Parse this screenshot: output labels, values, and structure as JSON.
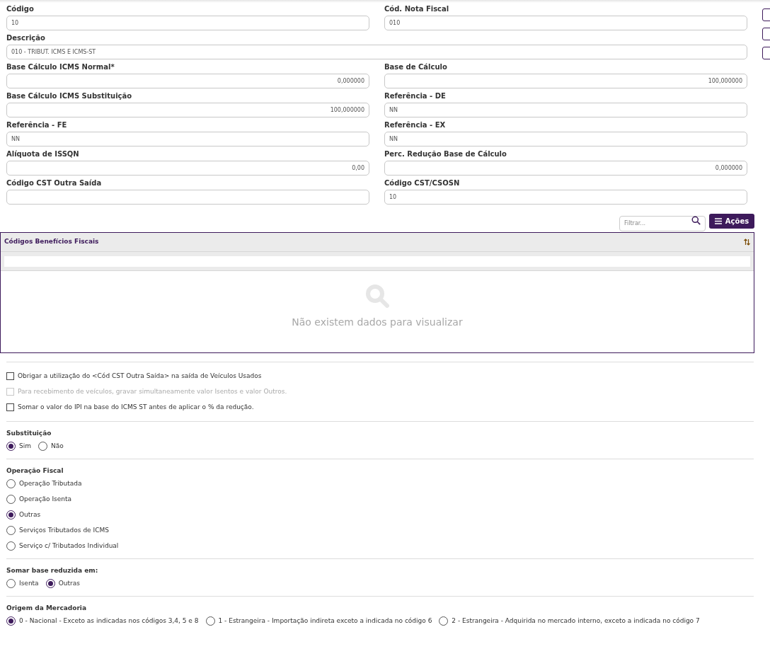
{
  "fields": [
    {
      "label": "Código",
      "value": "10",
      "kind": "text"
    },
    {
      "label": "Cód. Nota Fiscal",
      "value": "010",
      "kind": "text"
    },
    {
      "label": "Descrição",
      "value": "010 - TRIBUT. ICMS E ICMS-ST",
      "kind": "wide"
    },
    {
      "label": "Base Cálculo ICMS Normal*",
      "value": "0,000000",
      "kind": "number"
    },
    {
      "label": "Base de Cálculo",
      "value": "100,000000",
      "kind": "number"
    },
    {
      "label": "Base Cálculo ICMS Substituição",
      "value": "100,000000",
      "kind": "number"
    },
    {
      "label": "Referência - DE",
      "value": "NN",
      "kind": "text"
    },
    {
      "label": "Referência - FE",
      "value": "NN",
      "kind": "text"
    },
    {
      "label": "Referência - EX",
      "value": "NN",
      "kind": "text"
    },
    {
      "label": "Alíquota de ISSQN",
      "value": "0,00",
      "kind": "number"
    },
    {
      "label": "Perc. Redução Base de Cálculo",
      "value": "0,000000",
      "kind": "number"
    },
    {
      "label": "Código CST Outra Saída",
      "kind": "text"
    },
    {
      "label": "Código CST/CSOSN",
      "value": "10",
      "kind": "text"
    }
  ],
  "filter": {
    "placeholder": "Filtrar..."
  },
  "actions_button": {
    "label": "Ações"
  },
  "grid": {
    "title": "Códigos Benefícios Fiscais",
    "empty_message": "Não existem dados para visualizar"
  },
  "checkboxes": [
    {
      "label": "Obrigar a utilização do <Cód CST Outra Saída> na saída de Veículos Usados",
      "checked": false,
      "disabled": false
    },
    {
      "label": "Para recebimento de veículos, gravar simultaneamente valor Isentos e valor Outros.",
      "checked": false,
      "disabled": true
    },
    {
      "label": "Somar o valor do IPI na base do ICMS ST antes de aplicar o % da redução.",
      "checked": false,
      "disabled": false
    }
  ],
  "radio_groups": [
    {
      "title": "Substituição",
      "kind": "inline",
      "options": [
        {
          "label": "Sim",
          "selected": true
        },
        {
          "label": "Não",
          "selected": false
        }
      ]
    },
    {
      "title": "Operação Fiscal",
      "kind": "list",
      "options": [
        {
          "label": "Operação Tributada",
          "selected": false
        },
        {
          "label": "Operação Isenta",
          "selected": false
        },
        {
          "label": "Outras",
          "selected": true
        },
        {
          "label": "Serviços Tributados de ICMS",
          "selected": false
        },
        {
          "label": "Serviço c/ Tributados Individual",
          "selected": false
        }
      ]
    },
    {
      "title": "Somar base reduzida em:",
      "kind": "inline",
      "options": [
        {
          "label": "Isenta",
          "selected": false
        },
        {
          "label": "Outras",
          "selected": true
        }
      ]
    },
    {
      "title": "Origem da Mercadoria",
      "kind": "inline",
      "options": [
        {
          "label": "0 - Nacional - Exceto as indicadas nos códigos 3,4, 5 e 8",
          "selected": true
        },
        {
          "label": "1 - Estrangeira - Importação indireta exceto a indicada no código 6",
          "selected": false
        },
        {
          "label": "2 - Estrangeira - Adquirida no mercado interno, exceto a indicada no código 7",
          "selected": false
        }
      ]
    }
  ]
}
